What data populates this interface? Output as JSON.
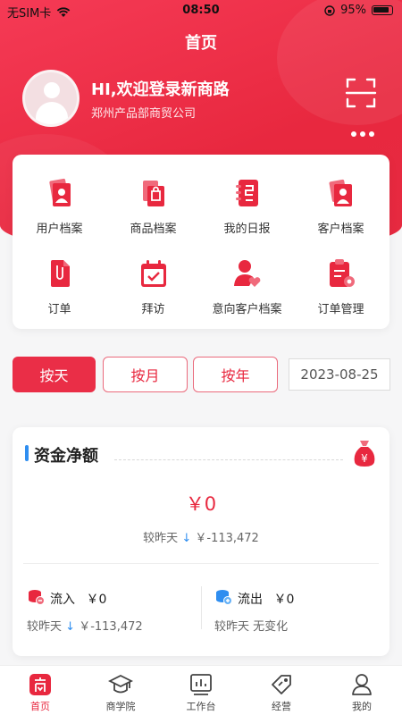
{
  "status_bar": {
    "carrier": "无SIM卡",
    "time": "08:50",
    "battery": "95%"
  },
  "header": {
    "title": "首页"
  },
  "profile": {
    "welcome": "HI,欢迎登录新商路",
    "company": "郑州产品部商贸公司"
  },
  "menu": {
    "items": [
      {
        "label": "用户档案",
        "icon": "user-file-icon"
      },
      {
        "label": "商品档案",
        "icon": "product-file-icon"
      },
      {
        "label": "我的日报",
        "icon": "daily-report-icon"
      },
      {
        "label": "客户档案",
        "icon": "customer-file-icon"
      },
      {
        "label": "订单",
        "icon": "order-icon"
      },
      {
        "label": "拜访",
        "icon": "visit-calendar-icon"
      },
      {
        "label": "意向客户档案",
        "icon": "prospect-customer-icon"
      },
      {
        "label": "订单管理",
        "icon": "order-management-icon"
      }
    ]
  },
  "period_tabs": {
    "day": "按天",
    "month": "按月",
    "year": "按年",
    "selected": "按天"
  },
  "date": "2023-08-25",
  "fund": {
    "title": "资金净额",
    "amount": "￥0",
    "compare_label": "较昨天",
    "compare_value": "￥-113,472",
    "inflow": {
      "label": "流入",
      "amount": "￥0",
      "compare_label": "较昨天",
      "compare_value": "￥-113,472"
    },
    "outflow": {
      "label": "流出",
      "amount": "￥0",
      "compare_text": "较昨天 无变化"
    }
  },
  "tabbar": {
    "items": [
      {
        "label": "首页",
        "icon": "home-icon"
      },
      {
        "label": "商学院",
        "icon": "graduation-cap-icon"
      },
      {
        "label": "工作台",
        "icon": "workbench-icon"
      },
      {
        "label": "经营",
        "icon": "tag-icon"
      },
      {
        "label": "我的",
        "icon": "profile-icon"
      }
    ],
    "active": "首页"
  },
  "colors": {
    "brand_red": "#e8283f",
    "accent_blue": "#2f8ef0"
  }
}
